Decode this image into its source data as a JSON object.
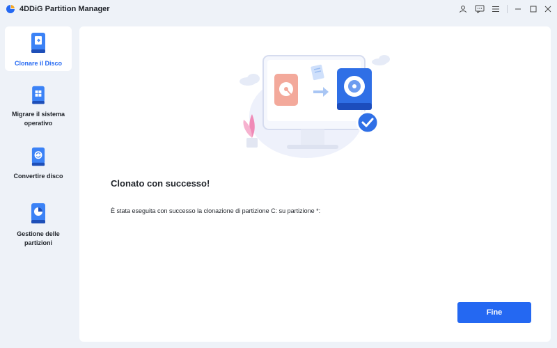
{
  "window": {
    "title": "4DDiG Partition Manager"
  },
  "titlebar_icons": [
    "user-icon",
    "feedback-icon",
    "menu-icon",
    "minimize-icon",
    "maximize-icon",
    "close-icon"
  ],
  "sidebar": {
    "items": [
      {
        "label": "Clonare il Disco",
        "icon": "clone-disk-icon",
        "active": true
      },
      {
        "label": "Migrare il sistema operativo",
        "icon": "migrate-os-icon",
        "active": false
      },
      {
        "label": "Convertire disco",
        "icon": "convert-disk-icon",
        "active": false
      },
      {
        "label": "Gestione delle partizioni",
        "icon": "partition-management-icon",
        "active": false
      }
    ]
  },
  "main": {
    "title": "Clonato con successo!",
    "message": "È stata eseguita con successo la clonazione di partizione C: su partizione *:",
    "finish_label": "Fine"
  },
  "colors": {
    "accent": "#2468f2",
    "background": "#eef2f8",
    "panel": "#ffffff"
  }
}
